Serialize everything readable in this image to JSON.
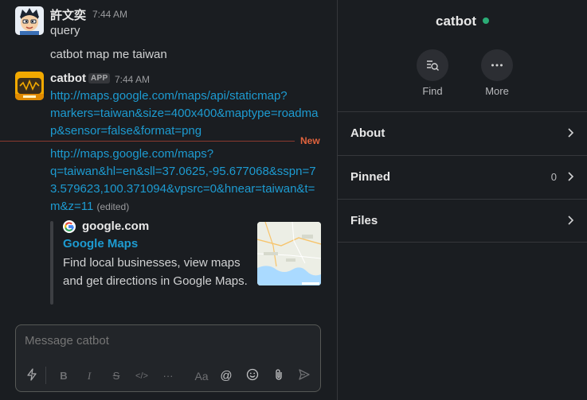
{
  "messages": [
    {
      "sender": "許文奕",
      "time": "7:44 AM",
      "lines": [
        "query",
        "catbot map me taiwan"
      ]
    },
    {
      "sender": "catbot",
      "badge": "APP",
      "time": "7:44 AM",
      "link1": [
        "http://maps.google.com/maps/api/staticmap?",
        "markers=taiwan&size=400x400&maptype=roadma",
        "p&sensor=false&format=png"
      ],
      "link2": [
        "http://maps.google.com/maps?",
        "q=taiwan&hl=en&sll=37.0625,-95.677068&sspn=7",
        "3.579623,100.371094&vpsrc=0&hnear=taiwan&t=",
        "m&z=11"
      ],
      "edited": "(edited)"
    }
  ],
  "new_divider": "New",
  "unfurl": {
    "site": "google.com",
    "title": "Google Maps",
    "description": "Find local businesses, view maps and get directions in Google Maps.",
    "favicon_icon": "google-g-icon"
  },
  "composer": {
    "placeholder": "Message catbot",
    "tools": [
      "lightning-icon",
      "bold-icon",
      "italic-icon",
      "strike-icon",
      "code-icon",
      "more-format-icon",
      "text-style-icon",
      "mention-icon",
      "emoji-icon",
      "attach-icon",
      "send-icon"
    ]
  },
  "details": {
    "title": "catbot",
    "status_color": "#2bac76",
    "actions": [
      {
        "label": "Find",
        "icon": "find-icon"
      },
      {
        "label": "More",
        "icon": "more-icon"
      }
    ],
    "rows": [
      {
        "label": "About",
        "count": ""
      },
      {
        "label": "Pinned",
        "count": "0"
      },
      {
        "label": "Files",
        "count": ""
      }
    ]
  },
  "colors": {
    "link": "#1d9bd1",
    "new": "#e0633d",
    "background": "#1a1d21"
  }
}
